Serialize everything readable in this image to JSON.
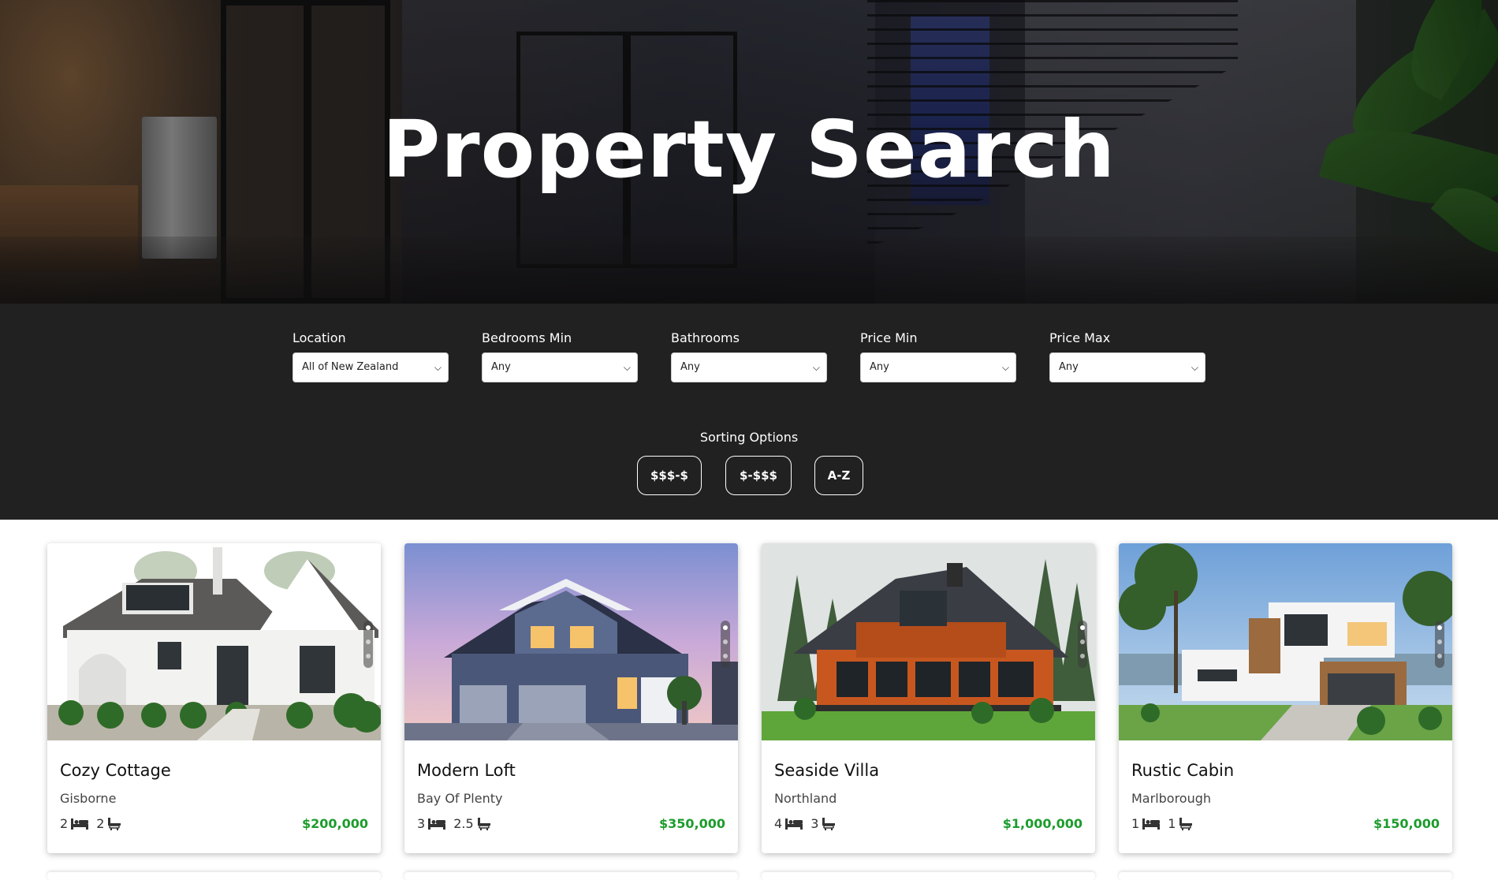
{
  "hero": {
    "title": "Property Search"
  },
  "filters": {
    "location": {
      "label": "Location",
      "value": "All of New Zealand"
    },
    "bedrooms_min": {
      "label": "Bedrooms Min",
      "value": "Any"
    },
    "bathrooms": {
      "label": "Bathrooms",
      "value": "Any"
    },
    "price_min": {
      "label": "Price Min",
      "value": "Any"
    },
    "price_max": {
      "label": "Price Max",
      "value": "Any"
    }
  },
  "sorting": {
    "title": "Sorting Options",
    "options": [
      "$$$-$",
      "$-$$$",
      "A-Z"
    ]
  },
  "listings": [
    {
      "title": "Cozy Cottage",
      "location": "Gisborne",
      "beds": "2",
      "baths": "2",
      "price": "$200,000"
    },
    {
      "title": "Modern Loft",
      "location": "Bay Of Plenty",
      "beds": "3",
      "baths": "2.5",
      "price": "$350,000"
    },
    {
      "title": "Seaside Villa",
      "location": "Northland",
      "beds": "4",
      "baths": "3",
      "price": "$1,000,000"
    },
    {
      "title": "Rustic Cabin",
      "location": "Marlborough",
      "beds": "1",
      "baths": "1",
      "price": "$150,000"
    }
  ],
  "colors": {
    "price": "#1c9c2c",
    "filter_bg": "#212121"
  },
  "icons": [
    "bed-icon",
    "bath-icon",
    "chevron-down-icon"
  ]
}
